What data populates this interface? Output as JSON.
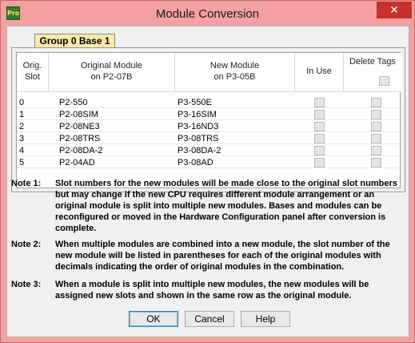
{
  "window": {
    "title": "Module Conversion",
    "app_icon_text": "Pro",
    "close_glyph": "✕"
  },
  "tab": {
    "label": "Group 0  Base 1"
  },
  "grid": {
    "headers": {
      "slot": [
        "Orig.",
        "Slot"
      ],
      "original": [
        "Original Module",
        "on P2-07B"
      ],
      "new": [
        "New Module",
        "on P3-05B"
      ],
      "in_use": "In Use",
      "delete_tags": "Delete Tags"
    },
    "rows": [
      {
        "slot": "0",
        "original": "P2-550",
        "new": "P3-550E"
      },
      {
        "slot": "1",
        "original": "P2-08SIM",
        "new": "P3-16SIM"
      },
      {
        "slot": "2",
        "original": "P2-08NE3",
        "new": "P3-16ND3"
      },
      {
        "slot": "3",
        "original": "P2-08TRS",
        "new": "P3-08TRS"
      },
      {
        "slot": "4",
        "original": "P2-08DA-2",
        "new": "P3-08DA-2"
      },
      {
        "slot": "5",
        "original": "P2-04AD",
        "new": "P3-08AD"
      }
    ]
  },
  "notes": [
    {
      "label": "Note 1:",
      "text": "Slot numbers for the new modules will be made close to the original slot numbers but may change if the new CPU requires different module arrangement or an original module is split into multiple new modules. Bases and modules can be reconfigured or moved in the Hardware Configuration panel after conversion is complete."
    },
    {
      "label": "Note 2:",
      "text": "When multiple modules are combined into a new module, the slot number of the new module will be listed in parentheses for each of the original modules with decimals indicating the order of original modules in the combination."
    },
    {
      "label": "Note 3:",
      "text": "When a module is split into multiple new modules, the new modules will be assigned new slots and shown in the same row as the original module."
    }
  ],
  "buttons": {
    "ok": "OK",
    "cancel": "Cancel",
    "help": "Help"
  }
}
